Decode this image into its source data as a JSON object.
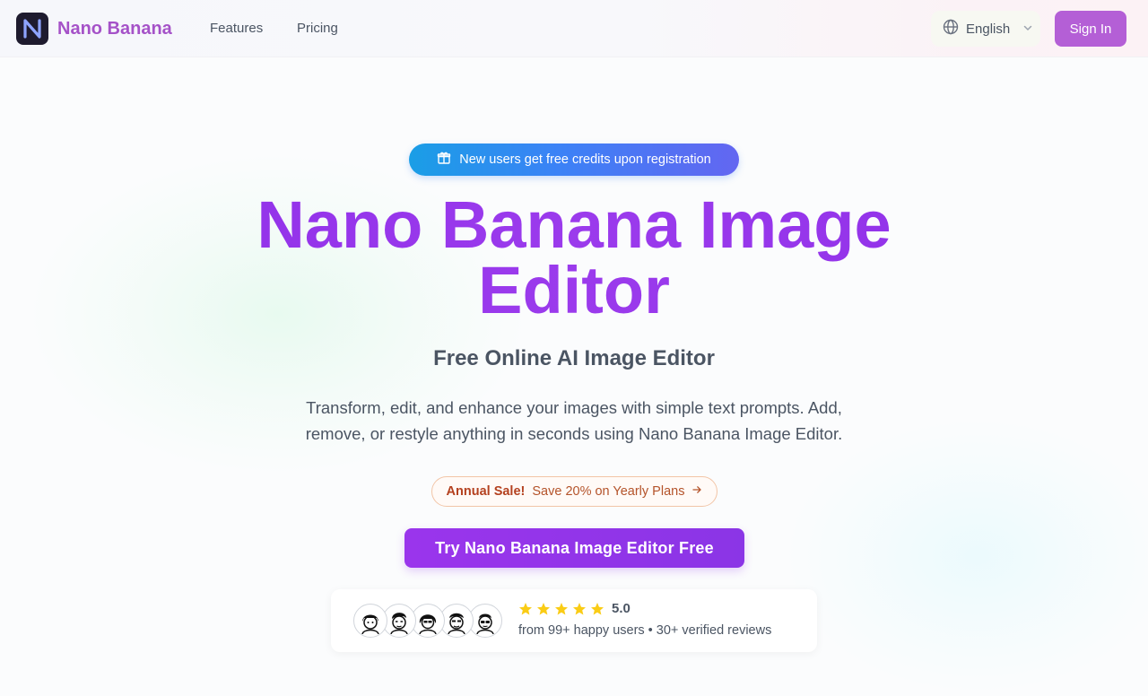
{
  "header": {
    "brand": "Nano Banana",
    "logo_letter": "N",
    "nav": [
      {
        "label": "Features"
      },
      {
        "label": "Pricing"
      }
    ],
    "language": {
      "selected": "English"
    },
    "sign_in_label": "Sign In"
  },
  "hero": {
    "promo_pill": "New users get free credits upon registration",
    "title_line1": "Nano Banana Image",
    "title_line2": "Editor",
    "subtitle": "Free Online AI Image Editor",
    "description_line1": "Transform, edit, and enhance your images with simple text prompts. Add,",
    "description_line2": "remove, or restyle anything in seconds using Nano Banana Image Editor.",
    "sale_strong": "Annual Sale!",
    "sale_text": "Save 20% on Yearly Plans",
    "cta_label": "Try Nano Banana Image Editor Free"
  },
  "reviews": {
    "rating": "5.0",
    "stars": 5,
    "summary": "from 99+ happy users • 30+ verified reviews",
    "avatar_count": 5
  },
  "colors": {
    "brand": "#a552c8",
    "title_purple": "#9333ea",
    "sign_in_bg": "#b45fd6",
    "pill_gradient_start": "#1a9ee6",
    "pill_gradient_end": "#6366f1",
    "star": "#facc15",
    "sale_text": "#b4532a"
  },
  "icons": {
    "logo": "n-logo-icon",
    "language": "globe-icon",
    "language_dropdown": "chevron-down-icon",
    "promo": "gift-icon",
    "sale_arrow": "arrow-right-icon",
    "star": "star-icon"
  }
}
